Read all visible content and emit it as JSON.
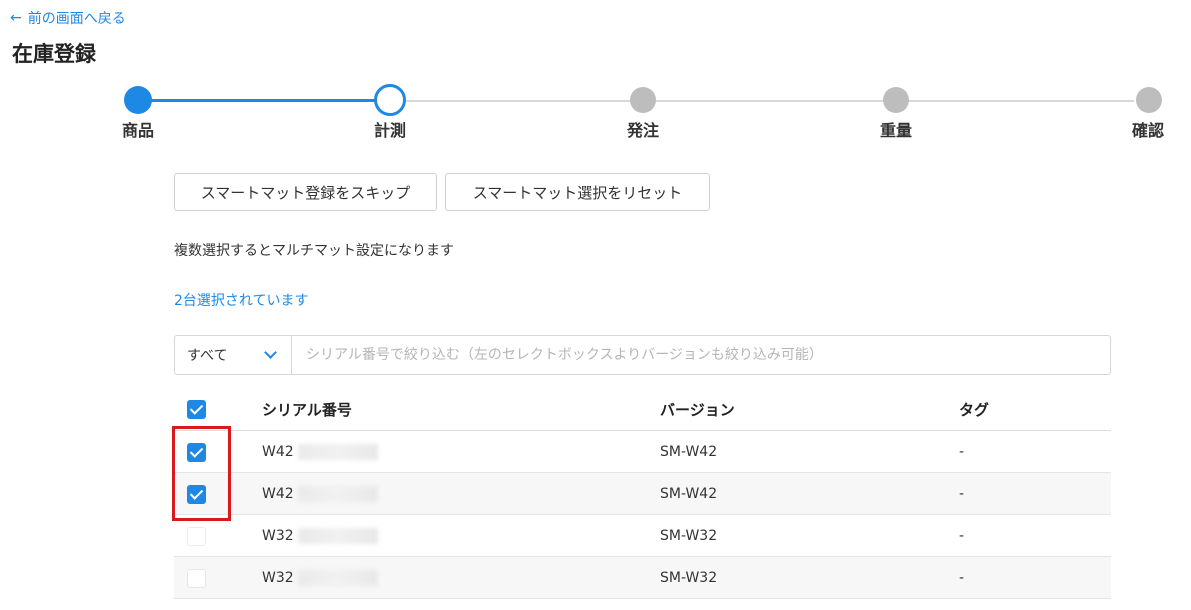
{
  "nav": {
    "back_label": "前の画面へ戻る",
    "back_icon": "arrow-left-icon"
  },
  "page": {
    "title": "在庫登録"
  },
  "stepper": {
    "steps": [
      {
        "label": "商品",
        "state": "done"
      },
      {
        "label": "計測",
        "state": "current"
      },
      {
        "label": "発注",
        "state": "todo"
      },
      {
        "label": "重量",
        "state": "todo"
      },
      {
        "label": "確認",
        "state": "todo"
      }
    ],
    "colors": {
      "active": "#1e88e5",
      "inactive": "#bdbdbd"
    }
  },
  "actions": {
    "skip_label": "スマートマット登録をスキップ",
    "reset_label": "スマートマット選択をリセット"
  },
  "hint": "複数選択するとマルチマット設定になります",
  "selected_count_text": "2台選択されています",
  "filter": {
    "select_value": "すべて",
    "search_placeholder": "シリアル番号で絞り込む（左のセレクトボックスよりバージョンも絞り込み可能）"
  },
  "table": {
    "columns": [
      "",
      "シリアル番号",
      "バージョン",
      "タグ"
    ],
    "header_checked": true,
    "rows": [
      {
        "checked": true,
        "serial": "W42",
        "version": "SM-W42",
        "tag": "-"
      },
      {
        "checked": true,
        "serial": "W42",
        "version": "SM-W42",
        "tag": "-"
      },
      {
        "checked": false,
        "serial": "W32",
        "version": "SM-W32",
        "tag": "-"
      },
      {
        "checked": false,
        "serial": "W32",
        "version": "SM-W32",
        "tag": "-"
      }
    ]
  }
}
